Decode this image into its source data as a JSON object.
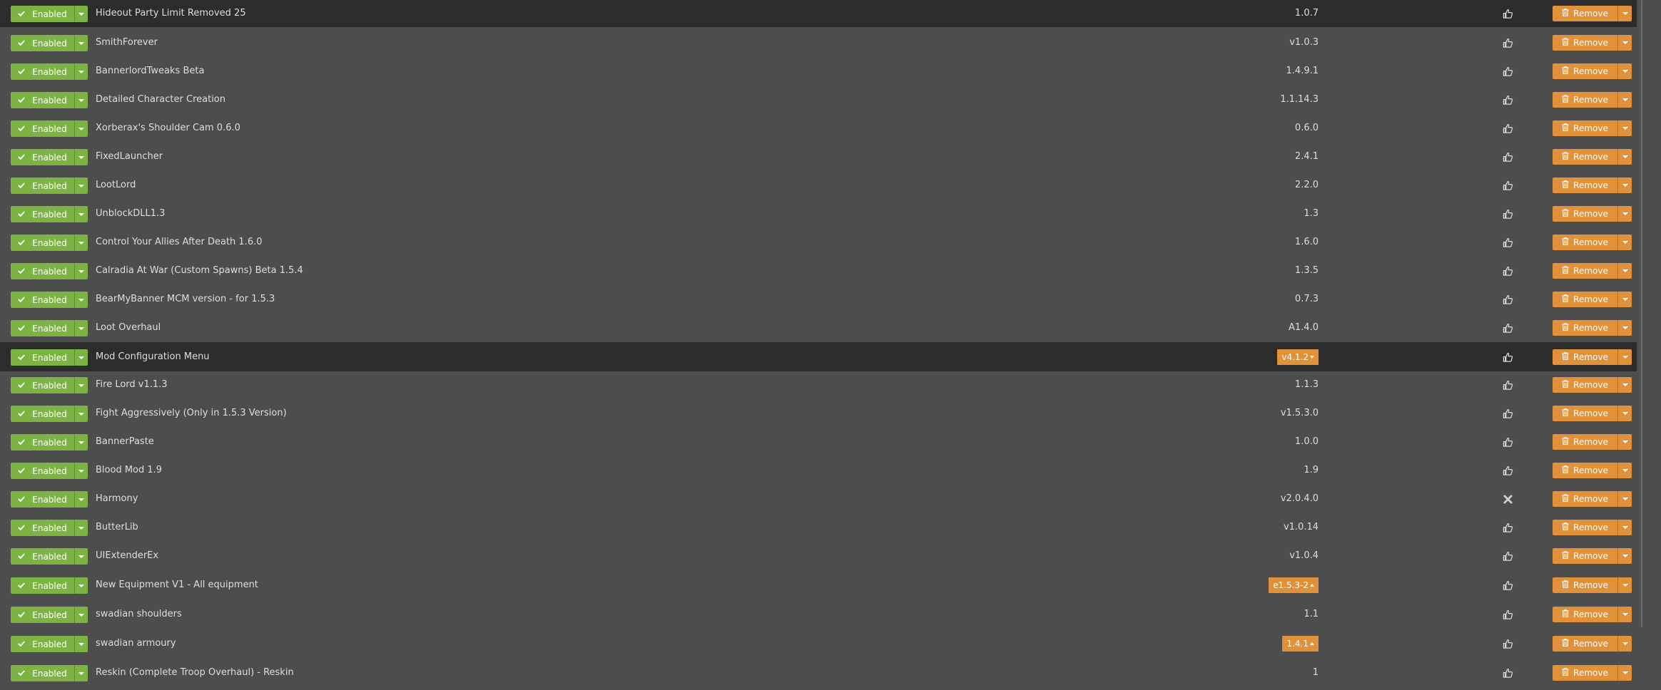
{
  "labels": {
    "enabled": "Enabled",
    "remove": "Remove"
  },
  "colors": {
    "enabled_green": "#7cb342",
    "remove_orange": "#e0913a",
    "row_background": "#4d4d4d",
    "row_highlight": "#2c2c2c"
  },
  "mods": [
    {
      "name": "Hideout Party Limit Removed 25",
      "version": "1.0.7",
      "endorse_icon": "thumbs-up-icon",
      "version_badge": false,
      "highlight": true
    },
    {
      "name": "SmithForever",
      "version": "v1.0.3",
      "endorse_icon": "thumbs-up-icon",
      "version_badge": false,
      "highlight": false
    },
    {
      "name": "BannerlordTweaks Beta",
      "version": "1.4.9.1",
      "endorse_icon": "thumbs-up-icon",
      "version_badge": false,
      "highlight": false
    },
    {
      "name": "Detailed Character Creation",
      "version": "1.1.14.3",
      "endorse_icon": "thumbs-up-icon",
      "version_badge": false,
      "highlight": false
    },
    {
      "name": "Xorberax's Shoulder Cam 0.6.0",
      "version": "0.6.0",
      "endorse_icon": "thumbs-up-icon",
      "version_badge": false,
      "highlight": false
    },
    {
      "name": "FixedLauncher",
      "version": "2.4.1",
      "endorse_icon": "thumbs-up-icon",
      "version_badge": false,
      "highlight": false
    },
    {
      "name": "LootLord",
      "version": "2.2.0",
      "endorse_icon": "thumbs-up-icon",
      "version_badge": false,
      "highlight": false
    },
    {
      "name": "UnblockDLL1.3",
      "version": "1.3",
      "endorse_icon": "thumbs-up-icon",
      "version_badge": false,
      "highlight": false
    },
    {
      "name": "Control Your Allies After Death 1.6.0",
      "version": "1.6.0",
      "endorse_icon": "thumbs-up-icon",
      "version_badge": false,
      "highlight": false
    },
    {
      "name": "Calradia At War (Custom Spawns) Beta 1.5.4",
      "version": "1.3.5",
      "endorse_icon": "thumbs-up-icon",
      "version_badge": false,
      "highlight": false
    },
    {
      "name": "BearMyBanner MCM version - for 1.5.3",
      "version": "0.7.3",
      "endorse_icon": "thumbs-up-icon",
      "version_badge": false,
      "highlight": false
    },
    {
      "name": "Loot Overhaul",
      "version": "A1.4.0",
      "endorse_icon": "thumbs-up-icon",
      "version_badge": false,
      "highlight": false
    },
    {
      "name": "Mod Configuration Menu",
      "version": "v4.1.2",
      "endorse_icon": "thumbs-up-icon",
      "version_badge": true,
      "badge_caret": "down",
      "highlight": true
    },
    {
      "name": "Fire Lord v1.1.3",
      "version": "1.1.3",
      "endorse_icon": "thumbs-up-icon",
      "version_badge": false,
      "highlight": false
    },
    {
      "name": "Fight Aggressively (Only in 1.5.3 Version)",
      "version": "v1.5.3.0",
      "endorse_icon": "thumbs-up-icon",
      "version_badge": false,
      "highlight": false
    },
    {
      "name": "BannerPaste",
      "version": "1.0.0",
      "endorse_icon": "thumbs-up-icon",
      "version_badge": false,
      "highlight": false
    },
    {
      "name": "Blood Mod 1.9",
      "version": "1.9",
      "endorse_icon": "thumbs-up-icon",
      "version_badge": false,
      "highlight": false
    },
    {
      "name": "Harmony",
      "version": "v2.0.4.0",
      "endorse_icon": "close-icon",
      "version_badge": false,
      "highlight": false
    },
    {
      "name": "ButterLib",
      "version": "v1.0.14",
      "endorse_icon": "thumbs-up-icon",
      "version_badge": false,
      "highlight": false
    },
    {
      "name": "UIExtenderEx",
      "version": "v1.0.4",
      "endorse_icon": "thumbs-up-icon",
      "version_badge": false,
      "highlight": false
    },
    {
      "name": "New Equipment V1 - All equipment",
      "version": "e1.5.3-2",
      "endorse_icon": "thumbs-up-icon",
      "version_badge": true,
      "badge_caret": "up",
      "highlight": false
    },
    {
      "name": "swadian shoulders",
      "version": "1.1",
      "endorse_icon": "thumbs-up-icon",
      "version_badge": false,
      "highlight": false
    },
    {
      "name": "swadian armoury",
      "version": "1.4.1",
      "endorse_icon": "thumbs-up-icon",
      "version_badge": true,
      "badge_caret": "up",
      "highlight": false
    },
    {
      "name": "Reskin (Complete Troop Overhaul) - Reskin",
      "version": "1",
      "endorse_icon": "thumbs-up-icon",
      "version_badge": false,
      "highlight": false
    }
  ]
}
